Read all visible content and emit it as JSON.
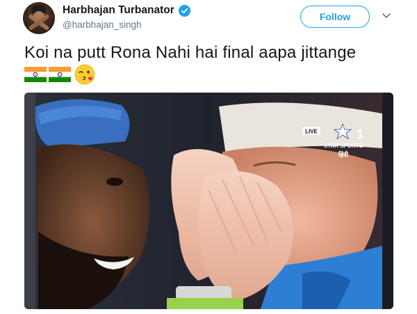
{
  "tweet": {
    "author": {
      "display_name": "Harbhajan Turbanator",
      "handle": "@harbhajan_singh",
      "verified": true,
      "avatar_icon": "profile-photo"
    },
    "follow_label": "Follow",
    "menu_icon": "chevron-down-icon",
    "text": "Koi na putt Rona Nahi hai final aapa jittange",
    "emojis": [
      "flag-india",
      "flag-india",
      "face-blowing-a-kiss"
    ],
    "media": {
      "type": "photo",
      "overlay": {
        "live_badge": "LIVE",
        "channel_number": "1",
        "channel_name": "STAR SPORTS",
        "channel_language": "हिंदी"
      }
    }
  },
  "colors": {
    "brand_blue": "#1da1f2",
    "text_primary": "#14171a",
    "text_secondary": "#657786"
  }
}
